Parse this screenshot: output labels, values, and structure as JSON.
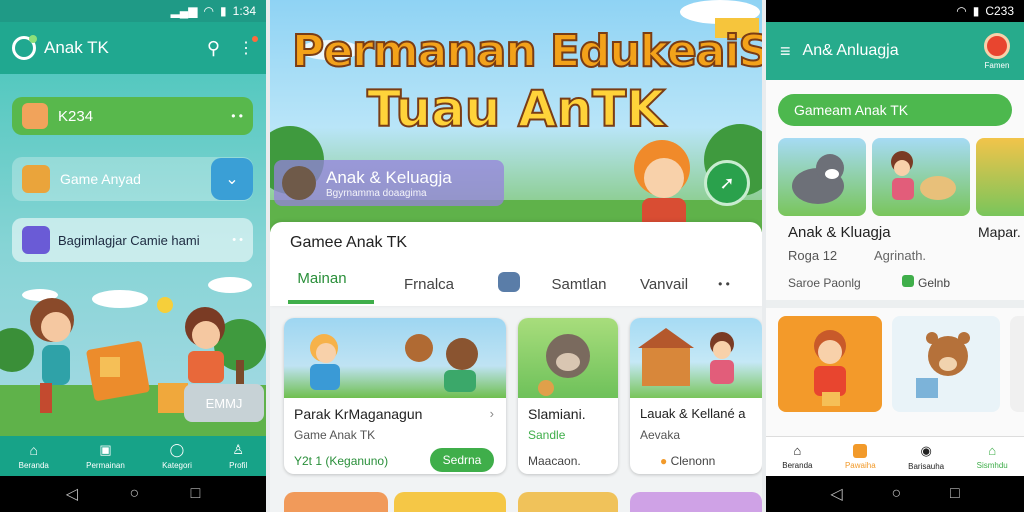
{
  "panel1": {
    "status": {
      "time": "1:34"
    },
    "app_title": "Anak TK",
    "items": [
      {
        "label": "K234"
      },
      {
        "label": "Game Anyad"
      },
      {
        "label": "Bagimlagjar Camie hami"
      }
    ],
    "overlay_badge": "EMMJ",
    "nav": [
      {
        "label": "Beranda"
      },
      {
        "label": "Permainan"
      },
      {
        "label": "Kategori"
      },
      {
        "label": "Profil"
      }
    ]
  },
  "panel2": {
    "banner": {
      "line1": "Permanan EdukeaiSeru",
      "line2": "Tuau AnTK",
      "profile_name": "Anak & Keluagja",
      "profile_sub": "Bgyrnamma doaagima"
    },
    "section_title": "Gamee Anak TK",
    "tabs": [
      {
        "label": "Mainan"
      },
      {
        "label": "Frnalca"
      },
      {
        "label": "Samtlan"
      },
      {
        "label": "Vanvail"
      }
    ],
    "cards": [
      {
        "title": "Parak KrMaganagun",
        "sub": "Game Anak TK",
        "foot": "Y2t 1 (Keganuno)",
        "button": "Sedrna"
      },
      {
        "title": "Slamiani.",
        "sub": "Sandle",
        "foot": "Maacaon."
      },
      {
        "title": "Lauak & Kellané a",
        "sub": "Aevaka",
        "foot": "Clenonn"
      }
    ]
  },
  "panel3": {
    "status": {
      "time": "C233"
    },
    "app_title": "An& Anluagja",
    "avatar_label": "Famen",
    "pill": "Gameam Anak TK",
    "featured": {
      "title": "Anak & Kluagja",
      "line2_a": "Roga 12",
      "line2_b": "Agrinath.",
      "foot_a": "Saroe Paonlg",
      "foot_b": "Gelnb",
      "side_title": "Mapar."
    },
    "nav": [
      {
        "label": "Beranda"
      },
      {
        "label": "Pawaiha"
      },
      {
        "label": "Barisauha"
      },
      {
        "label": "Sismhdu"
      }
    ]
  },
  "colors": {
    "teal": "#1fae96",
    "green": "#3fae4a",
    "orange": "#f29a2a"
  }
}
